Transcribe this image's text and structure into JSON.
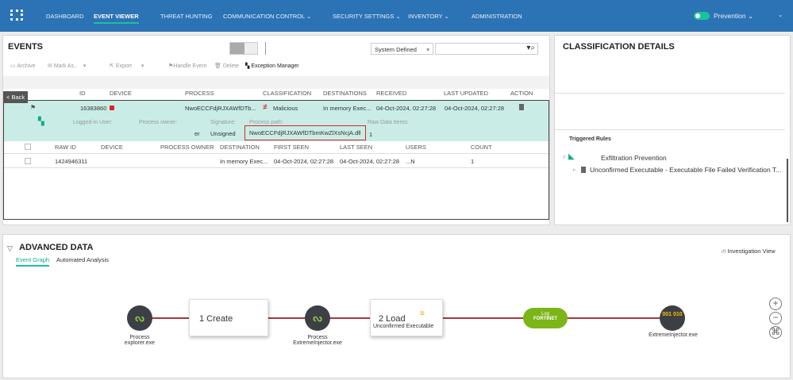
{
  "nav": {
    "items": [
      "DASHBOARD",
      "EVENT VIEWER",
      "THREAT HUNTING",
      "COMMUNICATION CONTROL",
      "SECURITY SETTINGS",
      "INVENTORY",
      "ADMINISTRATION"
    ],
    "mode": "Prevention"
  },
  "events": {
    "title": "EVENTS",
    "filter": "System Defined",
    "search_placeholder": "",
    "toolbar": [
      "Archive",
      "Mark As..",
      "Export",
      "Handle Event",
      "Delete",
      "Exception Manager"
    ],
    "back": "< Back",
    "columns": [
      "ID",
      "DEVICE",
      "PROCESS",
      "CLASSIFICATION",
      "DESTINATIONS",
      "RECEIVED",
      "LAST UPDATED",
      "ACTION"
    ],
    "row": {
      "id": "16383860",
      "process": "NwoECCFdjRJXAWfDTb...",
      "classification": "Malicious",
      "destinations": "In memory Exec...",
      "received": "04-Oct-2024, 02:27:28",
      "last_updated": "04-Oct-2024, 02:27:28"
    },
    "detail": {
      "labels": [
        "Logged-in User:",
        "Process owner:",
        "Signature:",
        "Process path:",
        "Raw Data Items:"
      ],
      "owner_tail": "er",
      "signature": "Unsigned",
      "path": "NwoECCFdjRJXAWfDTbmKwZlXsNcjA.dll",
      "raw_items": "1"
    },
    "raw_columns": [
      "RAW ID",
      "DEVICE",
      "PROCESS OWNER",
      "DESTINATION",
      "FIRST SEEN",
      "LAST SEEN",
      "USERS",
      "COUNT"
    ],
    "raw_row": {
      "raw_id": "1424946311",
      "destination": "In memory Exec...",
      "first_seen": "04-Oct-2024, 02:27:28",
      "last_seen": "04-Oct-2024, 02:27:28",
      "users": "...N",
      "count": "1"
    }
  },
  "classification": {
    "title": "CLASSIFICATION DETAILS",
    "triggered": "Triggered Rules",
    "rule_group": "Exfiltration Prevention",
    "rule": "Unconfirmed Executable - Executable File Failed Verification T..."
  },
  "advanced": {
    "title": "ADVANCED DATA",
    "tabs": [
      "Event Graph",
      "Automated Analysis"
    ],
    "investigation": "Investigation View",
    "graph": {
      "n1_type": "Process",
      "n1_name": "explorer.exe",
      "e1": "1 Create",
      "n2_type": "Process",
      "n2_name": "ExtremeInjector.exe",
      "e2": "2 Load",
      "e2_sub": "Unconfirmed Executable",
      "log": "Log",
      "log_brand": "FORTINET",
      "n3_name": "ExtremeInjector.exe",
      "n3_glyph": "001 010"
    }
  },
  "colors": {
    "nav": "#2c73b5",
    "accent": "#19c39a",
    "selected": "#c9ede6",
    "edge": "#a33b35",
    "log": "#7cb518"
  }
}
